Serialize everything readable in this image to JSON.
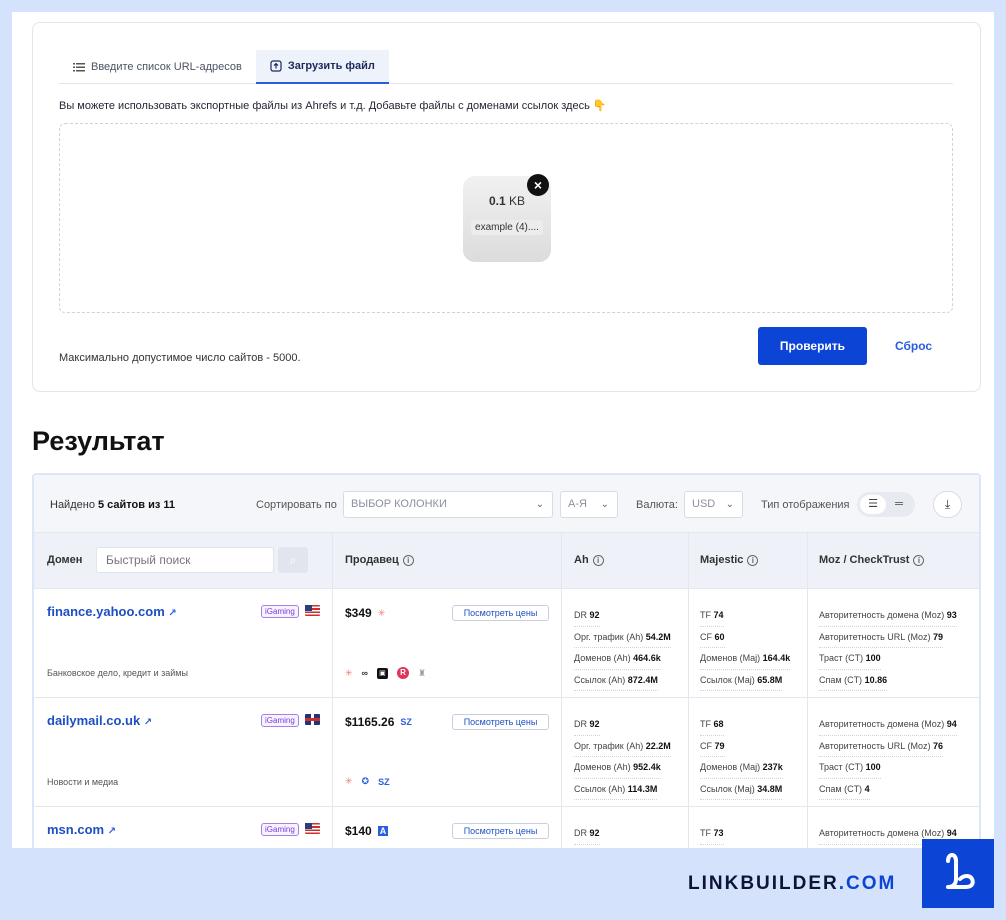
{
  "upload": {
    "tab_urls": "Введите список URL-адресов",
    "tab_upload": "Загрузить файл",
    "hint": "Вы можете использовать экспортные файлы из Ahrefs и т.д. Добавьте файлы с доменами ссылок здесь 👇",
    "file_size_value": "0.1",
    "file_size_unit": "KB",
    "file_name": "example (4)....",
    "max_note": "Максимально допустимое число сайтов - 5000.",
    "check_button": "Проверить",
    "reset_button": "Сброс"
  },
  "results": {
    "title": "Результат",
    "found_prefix": "Найдено",
    "found_count": "5 сайтов из 11",
    "sort_label": "Сортировать по",
    "sort_select": "ВЫБОР КОЛОНКИ",
    "order_select": "А-Я",
    "currency_label": "Валюта:",
    "currency_select": "USD",
    "view_label": "Тип отображения",
    "columns": {
      "domain": "Домен",
      "search_placeholder": "Быстрый поиск",
      "seller": "Продавец",
      "ah": "Ah",
      "majestic": "Majestic",
      "moz": "Moz / CheckTrust"
    },
    "price_button": "Посмотреть цены",
    "rows": [
      {
        "domain": "finance.yahoo.com",
        "badge": "iGaming",
        "flag": "us",
        "category": "Банковское дело, кредит и займы",
        "price": "$349",
        "ah": [
          [
            "DR",
            "92"
          ],
          [
            "Орг. трафик (Ah)",
            "54.2M"
          ],
          [
            "Доменов (Ah)",
            "464.6k"
          ],
          [
            "Ссылок (Ah)",
            "872.4M"
          ]
        ],
        "majestic": [
          [
            "TF",
            "74"
          ],
          [
            "CF",
            "60"
          ],
          [
            "Доменов (Maj)",
            "164.4k"
          ],
          [
            "Ссылок (Maj)",
            "65.8M"
          ]
        ],
        "moz": [
          [
            "Авторитетность домена (Moz)",
            "93"
          ],
          [
            "Авторитетность URL (Moz)",
            "79"
          ],
          [
            "Траст (CT)",
            "100"
          ],
          [
            "Спам (CT)",
            "10.86"
          ]
        ]
      },
      {
        "domain": "dailymail.co.uk",
        "badge": "iGaming",
        "flag": "uk",
        "category": "Новости и медиа",
        "price": "$1165.26",
        "ah": [
          [
            "DR",
            "92"
          ],
          [
            "Орг. трафик (Ah)",
            "22.2M"
          ],
          [
            "Доменов (Ah)",
            "952.4k"
          ],
          [
            "Ссылок (Ah)",
            "114.3M"
          ]
        ],
        "majestic": [
          [
            "TF",
            "68"
          ],
          [
            "CF",
            "79"
          ],
          [
            "Доменов (Maj)",
            "237k"
          ],
          [
            "Ссылок (Maj)",
            "34.8M"
          ]
        ],
        "moz": [
          [
            "Авторитетность домена (Moz)",
            "94"
          ],
          [
            "Авторитетность URL (Moz)",
            "76"
          ],
          [
            "Траст (CT)",
            "100"
          ],
          [
            "Спам (CT)",
            "4"
          ]
        ]
      },
      {
        "domain": "msn.com",
        "badge": "iGaming",
        "flag": "us",
        "category": "",
        "price": "$140",
        "ah": [
          [
            "DR",
            "92"
          ]
        ],
        "majestic": [
          [
            "TF",
            "73"
          ]
        ],
        "moz": [
          [
            "Авторитетность домена (Moz)",
            "94"
          ]
        ]
      }
    ]
  },
  "brand": {
    "name": "LINKBUILDER",
    "tld": ".COM",
    "accent": "#0c45d6"
  }
}
